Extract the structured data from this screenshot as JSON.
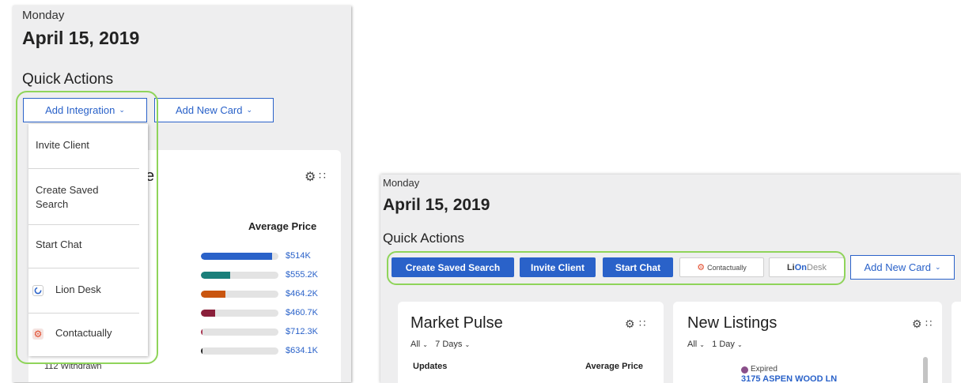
{
  "left": {
    "day": "Monday",
    "date": "April 15, 2019",
    "quick_actions": "Quick Actions",
    "add_integration": "Add Integration",
    "add_new_card": "Add New Card",
    "dropdown": {
      "invite_client": "Invite Client",
      "create_saved_search": "Create Saved Search",
      "start_chat": "Start Chat",
      "lion_desk": "Lion Desk",
      "contactually": "Contactually"
    },
    "card_title_fragment": "se",
    "average_price": "Average Price",
    "bottom_row_label": "112 Withdrawn",
    "bars": [
      {
        "price": "$514K",
        "fraction": 0.92,
        "color": "#2a62c9"
      },
      {
        "price": "$555.2K",
        "fraction": 0.38,
        "color": "#1a7f7a"
      },
      {
        "price": "$464.2K",
        "fraction": 0.32,
        "color": "#c9550f"
      },
      {
        "price": "$460.7K",
        "fraction": 0.18,
        "color": "#8a1f3a"
      },
      {
        "price": "$712.3K",
        "fraction": 0.02,
        "color": "#a83350"
      },
      {
        "price": "$634.1K",
        "fraction": 0.02,
        "color": "#222222"
      }
    ]
  },
  "right": {
    "day": "Monday",
    "date": "April 15, 2019",
    "quick_actions": "Quick Actions",
    "create_saved_search": "Create Saved Search",
    "invite_client": "Invite Client",
    "start_chat": "Start Chat",
    "contactually": "Contactually",
    "liondesk_a": "Li",
    "liondesk_b": "On",
    "liondesk_c": "Desk",
    "add_new_card": "Add New Card",
    "market_pulse": {
      "title": "Market Pulse",
      "filter_all": "All",
      "filter_days": "7 Days",
      "updates": "Updates",
      "average_price": "Average Price"
    },
    "new_listings": {
      "title": "New Listings",
      "filter_all": "All",
      "filter_days": "1 Day",
      "status": "Expired",
      "address": "3175 ASPEN WOOD LN"
    }
  },
  "colors": {
    "accent": "#2a62c9",
    "highlight": "#8fd45a"
  }
}
